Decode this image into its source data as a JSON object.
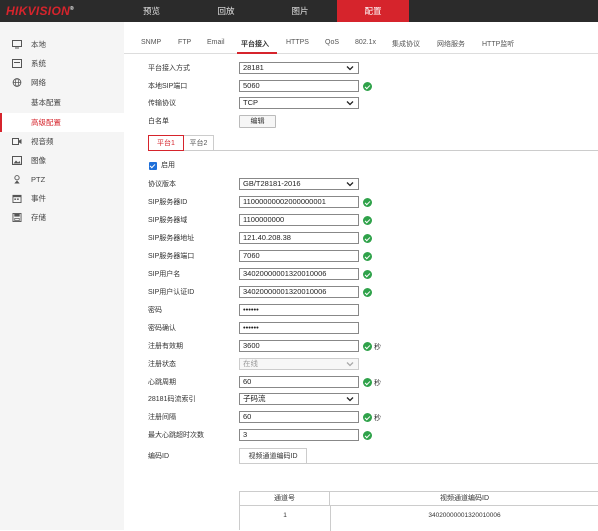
{
  "brand": {
    "logo_main": "HIKVISION",
    "logo_mark": "®"
  },
  "nav": [
    {
      "label": "预览",
      "active": false
    },
    {
      "label": "回放",
      "active": false
    },
    {
      "label": "图片",
      "active": false
    },
    {
      "label": "配置",
      "active": true
    }
  ],
  "sidebar": {
    "items": [
      {
        "label": "本地",
        "icon": "monitor-icon"
      },
      {
        "label": "系统",
        "icon": "system-icon"
      },
      {
        "label": "网络",
        "icon": "globe-icon"
      },
      {
        "label": "基本配置",
        "sub": true
      },
      {
        "label": "高级配置",
        "sub": true,
        "active": true
      },
      {
        "label": "视音频",
        "icon": "video-icon"
      },
      {
        "label": "图像",
        "icon": "image-icon"
      },
      {
        "label": "PTZ",
        "icon": "ptz-icon"
      },
      {
        "label": "事件",
        "icon": "calendar-icon"
      },
      {
        "label": "存储",
        "icon": "disk-icon"
      }
    ]
  },
  "tabs": [
    {
      "label": "SNMP"
    },
    {
      "label": "FTP"
    },
    {
      "label": "Email"
    },
    {
      "label": "平台接入",
      "active": true
    },
    {
      "label": "HTTPS"
    },
    {
      "label": "QoS"
    },
    {
      "label": "802.1x"
    },
    {
      "label": "集成协议"
    },
    {
      "label": "网络服务"
    },
    {
      "label": "HTTP监听"
    }
  ],
  "top_form": {
    "access_mode_label": "平台接入方式",
    "access_mode_value": "28181",
    "local_sip_port_label": "本地SIP端口",
    "local_sip_port_value": "5060",
    "transport_label": "传输协议",
    "transport_value": "TCP",
    "whitelist_label": "白名单",
    "edit_label": "编辑"
  },
  "platform_tabs": [
    {
      "label": "平台1",
      "active": true
    },
    {
      "label": "平台2"
    }
  ],
  "platform": {
    "enable_label": "启用",
    "enabled": true,
    "protocol_version_label": "协议版本",
    "protocol_version_value": "GB/T28181-2016",
    "sip_server_id_label": "SIP服务器ID",
    "sip_server_id_value": "11000000002000000001",
    "sip_server_domain_label": "SIP服务器域",
    "sip_server_domain_value": "1100000000",
    "sip_server_addr_label": "SIP服务器地址",
    "sip_server_addr_value": "121.40.208.38",
    "sip_server_port_label": "SIP服务器端口",
    "sip_server_port_value": "7060",
    "sip_username_label": "SIP用户名",
    "sip_username_value": "34020000001320010006",
    "sip_auth_id_label": "SIP用户认证ID",
    "sip_auth_id_value": "34020000001320010006",
    "password_label": "密码",
    "password_value": "••••••",
    "password_confirm_label": "密码确认",
    "password_confirm_value": "••••••",
    "reg_validity_label": "注册有效期",
    "reg_validity_value": "3600",
    "reg_validity_unit": "秒",
    "reg_status_label": "注册状态",
    "reg_status_value": "在线",
    "heartbeat_label": "心跳周期",
    "heartbeat_value": "60",
    "heartbeat_unit": "秒",
    "stream_index_label": "28181码流索引",
    "stream_index_value": "子码流",
    "reg_interval_label": "注册间隔",
    "reg_interval_value": "60",
    "reg_interval_unit": "秒",
    "max_timeout_label": "最大心跳超时次数",
    "max_timeout_value": "3",
    "encode_id_label": "编码ID",
    "encode_id_tab": "视频通道编码ID"
  },
  "encode_table": {
    "headers": [
      "通道号",
      "视频通道编码ID"
    ],
    "rows": [
      [
        "1",
        "34020000001320010006"
      ]
    ]
  },
  "colors": {
    "accent": "#d6242c",
    "ok": "#2fa24a",
    "topbar": "#2b2b2b",
    "checkbox": "#1e6fd9"
  }
}
